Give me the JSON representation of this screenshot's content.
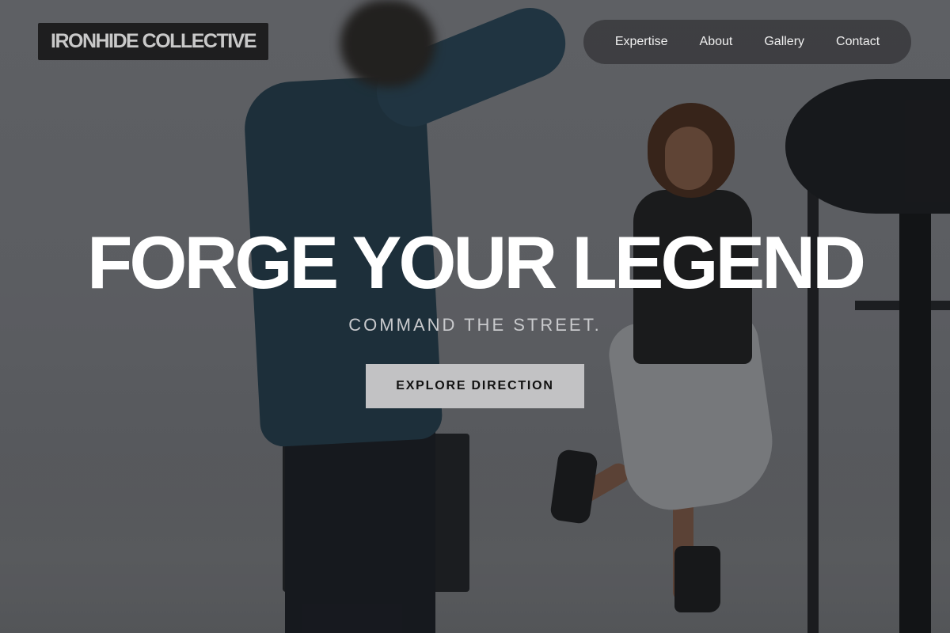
{
  "brand": {
    "name": "IRONHIDE COLLECTIVE"
  },
  "nav": {
    "items": [
      {
        "label": "Expertise"
      },
      {
        "label": "About"
      },
      {
        "label": "Gallery"
      },
      {
        "label": "Contact"
      }
    ]
  },
  "hero": {
    "headline": "FORGE YOUR LEGEND",
    "subheadline": "COMMAND THE STREET.",
    "cta_label": "EXPLORE DIRECTION",
    "background_image": "photo-studio-photographer-and-model"
  },
  "colors": {
    "nav_pill": "#3a3a3d",
    "logo_box": "#1e1e1f",
    "cta_bg": "#c2c2c4",
    "headline": "#ffffff"
  }
}
